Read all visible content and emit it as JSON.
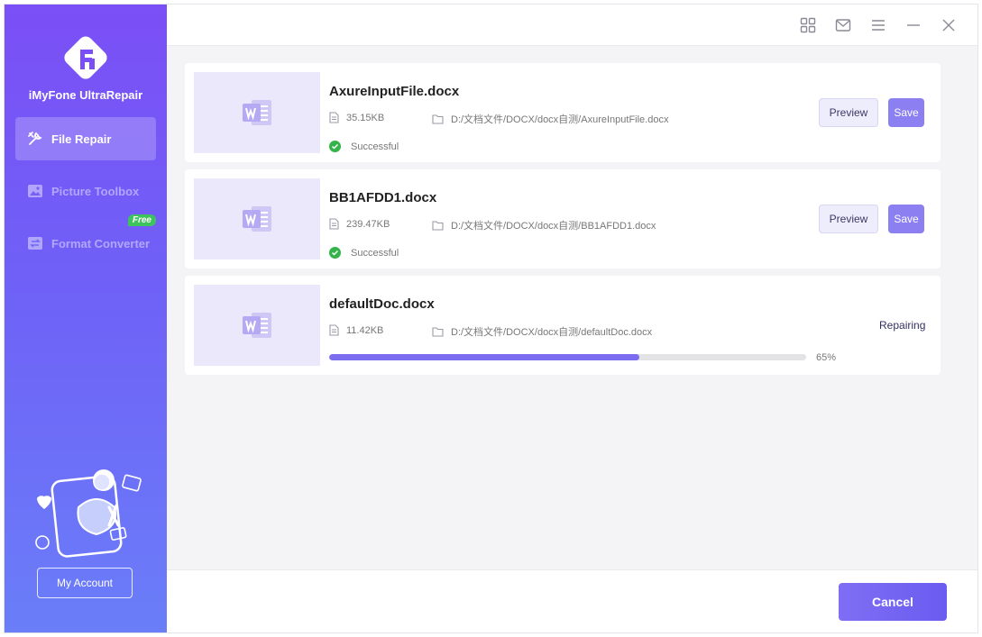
{
  "app": {
    "name": "iMyFone UltraRepair"
  },
  "sidebar": {
    "items": [
      {
        "label": "File Repair",
        "icon": "wrench-icon",
        "active": true
      },
      {
        "label": "Picture Toolbox",
        "icon": "picture-icon",
        "active": false
      },
      {
        "label": "Format Converter",
        "icon": "convert-icon",
        "active": false,
        "badge": "Free"
      }
    ],
    "account_label": "My Account"
  },
  "topbar": {
    "icons": [
      "grid-icon",
      "mail-icon",
      "menu-icon",
      "minimize-icon",
      "close-icon"
    ]
  },
  "files": [
    {
      "name": "AxureInputFile.docx",
      "size": "35.15KB",
      "path": "D:/文档文件/DOCX/docx自测/AxureInputFile.docx",
      "status": "Successful",
      "preview_label": "Preview",
      "save_label": "Save"
    },
    {
      "name": "BB1AFDD1.docx",
      "size": "239.47KB",
      "path": "D:/文档文件/DOCX/docx自测/BB1AFDD1.docx",
      "status": "Successful",
      "preview_label": "Preview",
      "save_label": "Save"
    },
    {
      "name": "defaultDoc.docx",
      "size": "11.42KB",
      "path": "D:/文档文件/DOCX/docx自测/defaultDoc.docx",
      "status": "Repairing",
      "progress": 65,
      "progress_text": "65%"
    }
  ],
  "bottom": {
    "cancel_label": "Cancel"
  },
  "colors": {
    "accent": "#7c6cf0",
    "sidebar_top": "#7b4ff6",
    "sidebar_bottom": "#6a7ef8",
    "success": "#34b34a",
    "free_badge": "#3ec45c"
  }
}
